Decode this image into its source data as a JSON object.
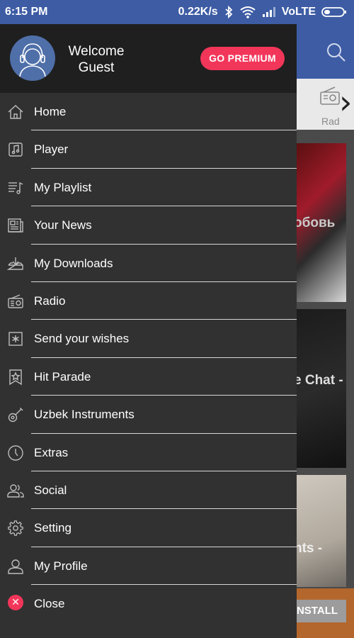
{
  "status_bar": {
    "time": "6:15 PM",
    "net_speed": "0.22K/s",
    "network": "VoLTE",
    "color": "#3d5ca4"
  },
  "drawer": {
    "welcome_line1": "Welcome",
    "welcome_line2": "Guest",
    "premium_label": "GO PREMIUM",
    "accent_color": "#f2365a",
    "menu": [
      {
        "icon": "home-icon",
        "label": "Home"
      },
      {
        "icon": "player-icon",
        "label": "Player"
      },
      {
        "icon": "playlist-icon",
        "label": "My Playlist"
      },
      {
        "icon": "news-icon",
        "label": "Your News"
      },
      {
        "icon": "download-icon",
        "label": "My Downloads"
      },
      {
        "icon": "radio-icon",
        "label": "Radio"
      },
      {
        "icon": "wishes-icon",
        "label": "Send your wishes"
      },
      {
        "icon": "star-bookmark-icon",
        "label": "Hit Parade"
      },
      {
        "icon": "guitar-icon",
        "label": "Uzbek Instruments"
      },
      {
        "icon": "clock-icon",
        "label": "Extras"
      },
      {
        "icon": "people-icon",
        "label": "Social"
      },
      {
        "icon": "gear-icon",
        "label": "Setting"
      },
      {
        "icon": "user-icon",
        "label": "My Profile"
      },
      {
        "icon": "close-icon",
        "label": "Close"
      }
    ]
  },
  "background": {
    "tab_label": "Rad",
    "card1_text": "обовь",
    "card2_text": "e Chat -",
    "card3_text": "nts -",
    "install_label": "NSTALL"
  }
}
